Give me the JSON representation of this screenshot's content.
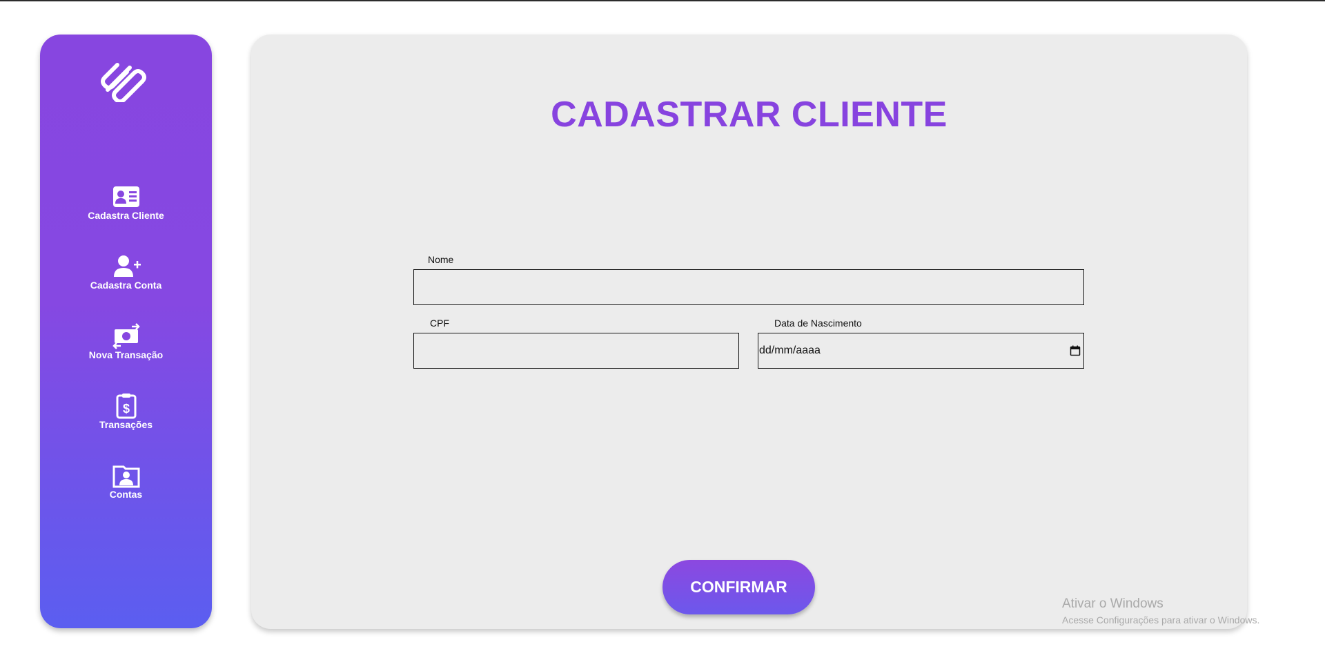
{
  "colors": {
    "accent": "#8743df",
    "sidebar_top": "#8746e0",
    "sidebar_bottom": "#5b5ef0",
    "panel_bg": "#ececec"
  },
  "sidebar": {
    "logo_icon": "paperclip-logo-icon",
    "items": [
      {
        "label": "Cadastra Cliente",
        "icon": "id-card-icon"
      },
      {
        "label": "Cadastra Conta",
        "icon": "user-plus-icon"
      },
      {
        "label": "Nova Transação",
        "icon": "money-transfer-icon"
      },
      {
        "label": "Transações",
        "icon": "clipboard-dollar-icon"
      },
      {
        "label": "Contas",
        "icon": "user-folder-icon"
      }
    ]
  },
  "main": {
    "title": "CADASTRAR CLIENTE",
    "fields": {
      "nome": {
        "label": "Nome",
        "value": ""
      },
      "cpf": {
        "label": "CPF",
        "value": ""
      },
      "nascimento": {
        "label": "Data de Nascimento",
        "value": "dd/mm/aaaa",
        "icon": "calendar-icon"
      }
    },
    "confirm_label": "CONFIRMAR"
  },
  "watermark": {
    "title": "Ativar o Windows",
    "subtitle": "Acesse Configurações para ativar o Windows."
  }
}
